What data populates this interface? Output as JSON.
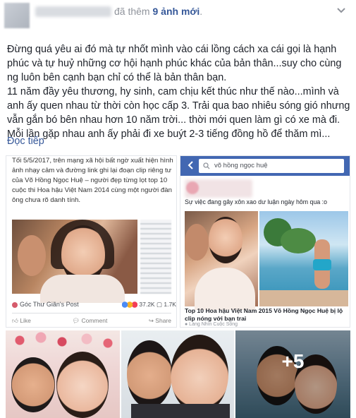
{
  "header": {
    "action_prefix": "đã thêm",
    "photo_count_label": "9 ảnh mới",
    "suffix": "."
  },
  "post": {
    "paragraph1": "Đừng quá yêu ai đó mà tự nhốt mình vào cái lồng cách xa cái gọi là hạnh phúc và tự huỷ những cơ hội hạnh phúc khác của bản thân...suy cho cùng ng luôn bên cạnh bạn chỉ có thể là bản thân bạn.",
    "paragraph2": "11 năm đầy yêu thương, hy sinh, cam chịu kết thúc như thế nào...mình và anh ấy quen nhau từ thời còn học cấp 3. Trải qua bao nhiêu sóng gió nhưng vẫn gắn bó bên nhau hơn 10 năm trời... thời mới quen làm gì có xe mà đi. Mỗi lần gặp nhau anh ấy phải đi xe buýt 2-3 tiếng đồng hồ để thăm mì...",
    "read_more": "Đọc tiếp"
  },
  "photos": {
    "tile1": {
      "story": "Tối 5/5/2017, trên mạng xã hội bất ngờ xuất hiện hình ảnh nhạy cảm và đường link ghi lại đoạn clip riêng tư của Võ Hồng Ngọc Huệ – người đẹp từng lọt top 10 cuộc thi Hoa hậu Việt Nam 2014 cùng một người đàn ông chưa rõ danh tính.",
      "source": "Góc Thư Giãn's Post",
      "reaction_count": "37.2K",
      "comment_count": "1.7K",
      "like_label": "Like",
      "comment_label": "Comment",
      "share_label": "Share"
    },
    "tile2": {
      "search_query": "võ hồng ngọc huệ",
      "subheadline": "Sự việc đang gây xôn xao dư luận ngày hôm qua :o",
      "headline": "Top 10 Hoa hậu Việt Nam 2015 Võ Hồng Ngọc Huệ bị lộ clip nóng với bạn trai",
      "source": "● Làng Nhìn Cuộc Sống"
    },
    "more_count": "+5"
  }
}
